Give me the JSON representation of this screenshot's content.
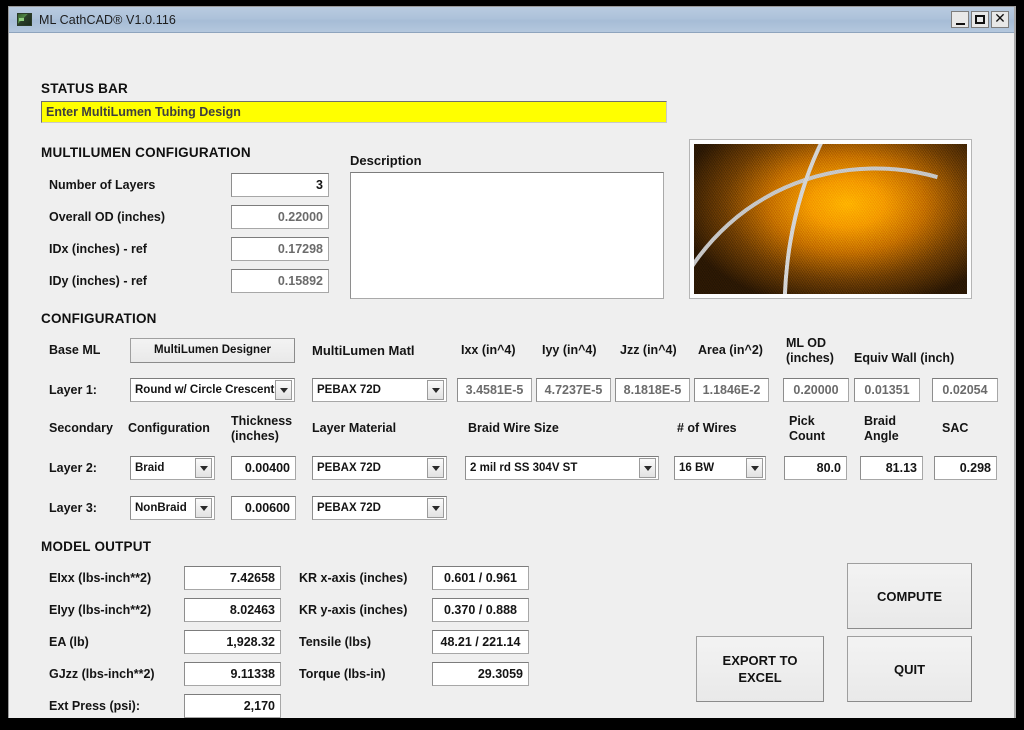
{
  "window": {
    "title": "ML CathCAD® V1.0.116",
    "icon": "app-icon",
    "minimize_label": "_",
    "maximize_label": "□",
    "close_label": "✕"
  },
  "status": {
    "heading": "STATUS BAR",
    "message": "Enter MultiLumen Tubing Design",
    "background_color": "#ffff00"
  },
  "multilumen_configuration": {
    "heading": "MULTILUMEN CONFIGURATION",
    "fields": [
      {
        "label": "Number of Layers",
        "value": "3",
        "readonly": false
      },
      {
        "label": "Overall OD (inches)",
        "value": "0.22000",
        "readonly": true
      },
      {
        "label": "IDx (inches) - ref",
        "value": "0.17298",
        "readonly": true
      },
      {
        "label": "IDy (inches) - ref",
        "value": "0.15892",
        "readonly": true
      }
    ]
  },
  "description": {
    "label": "Description",
    "value": "",
    "placeholder": ""
  },
  "preview_image": {
    "name": "braided-catheter-tubing-image",
    "alt": "Braided catheter tubing strands on orange background"
  },
  "configuration": {
    "heading": "CONFIGURATION",
    "base_ml_label": "Base ML",
    "designer_button": "MultiLumen Designer",
    "headers": {
      "multilumen_matl": "MultiLumen Matl",
      "ixx": "Ixx (in^4)",
      "iyy": "Iyy (in^4)",
      "jzz": "Jzz (in^4)",
      "area": "Area (in^2)",
      "ml_od": "ML OD\n(inches)",
      "equiv_wall": "Equiv Wall (inch)"
    },
    "layer1": {
      "label": "Layer 1:",
      "geometry": "Round w/ Circle Crescent M",
      "material": "PEBAX 72D",
      "ixx": "3.4581E-5",
      "iyy": "4.7237E-5",
      "jzz": "8.1818E-5",
      "area": "1.1846E-2",
      "ml_od": "0.20000",
      "equiv_wall_1": "0.01351",
      "equiv_wall_2": "0.02054"
    }
  },
  "secondary": {
    "headers": {
      "secondary": "Secondary",
      "configuration": "Configuration",
      "thickness": "Thickness\n(inches)",
      "layer_material": "Layer Material",
      "braid_wire_size": "Braid Wire Size",
      "num_wires": "# of Wires",
      "pick_count": "Pick\nCount",
      "braid_angle": "Braid\nAngle",
      "sac": "SAC"
    },
    "layer2": {
      "label": "Layer 2:",
      "configuration": "Braid",
      "thickness": "0.00400",
      "material": "PEBAX 72D",
      "braid_wire_size": "2 mil rd SS 304V ST",
      "num_wires": "16 BW",
      "pick_count": "80.0",
      "braid_angle": "81.13",
      "sac": "0.298"
    },
    "layer3": {
      "label": "Layer 3:",
      "configuration": "NonBraid",
      "thickness": "0.00600",
      "material": "PEBAX 72D"
    }
  },
  "model_output": {
    "heading": "MODEL OUTPUT",
    "left": [
      {
        "label": "EIxx (lbs-inch**2)",
        "value": "7.42658"
      },
      {
        "label": "EIyy (lbs-inch**2)",
        "value": "8.02463"
      },
      {
        "label": "EA (lb)",
        "value": "1,928.32"
      },
      {
        "label": "GJzz (lbs-inch**2)",
        "value": "9.11338"
      },
      {
        "label": "Ext Press (psi):",
        "value": "2,170"
      }
    ],
    "right": [
      {
        "label": "KR x-axis (inches)",
        "value": "0.601 / 0.961"
      },
      {
        "label": "KR y-axis (inches)",
        "value": "0.370 / 0.888"
      },
      {
        "label": "Tensile (lbs)",
        "value": "48.21 / 221.14"
      },
      {
        "label": "Torque (lbs-in)",
        "value": "29.3059"
      }
    ]
  },
  "actions": {
    "compute": "COMPUTE",
    "export_excel": "EXPORT TO\nEXCEL",
    "quit": "QUIT"
  }
}
